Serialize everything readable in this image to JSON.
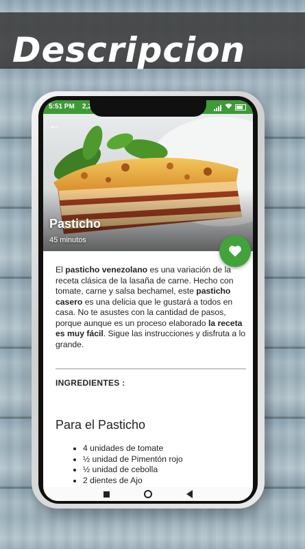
{
  "banner": {
    "title": "Descripcion"
  },
  "status_bar": {
    "time": "5:51 PM",
    "data_speed": "2,2"
  },
  "recipe": {
    "title": "Pasticho",
    "time": "45 minutos",
    "description_parts": [
      {
        "text": "El ",
        "bold": false
      },
      {
        "text": "pasticho venezolano",
        "bold": true
      },
      {
        "text": " es una variación de la receta clásica de la lasaña de carne. Hecho con tomate, carne y salsa bechamel, este ",
        "bold": false
      },
      {
        "text": "pasticho casero",
        "bold": true
      },
      {
        "text": " es una delicia que le gustará a todos en casa. No te asustes con la cantidad de pasos, porque aunque es un proceso elaborado ",
        "bold": false
      },
      {
        "text": "la receta es muy fácil",
        "bold": true
      },
      {
        "text": ". Sigue las instrucciones y disfruta a lo grande.",
        "bold": false
      }
    ],
    "ingredients_heading": "INGREDIENTES :",
    "section_heading": "Para el Pasticho",
    "ingredients": [
      "4 unidades de tomate",
      "½ unidad de Pimentón rojo",
      "½ unidad de cebolla",
      "2 dientes de Ajo"
    ]
  },
  "colors": {
    "accent_green": "#43a33b",
    "status_bar_green": "#3d9a36",
    "banner_background": "#3c3c3c"
  },
  "icons": {
    "favorite": "heart-icon",
    "back": "back-arrow-icon",
    "nav_recent": "square-icon",
    "nav_home": "circle-icon",
    "nav_back": "triangle-back-icon"
  }
}
